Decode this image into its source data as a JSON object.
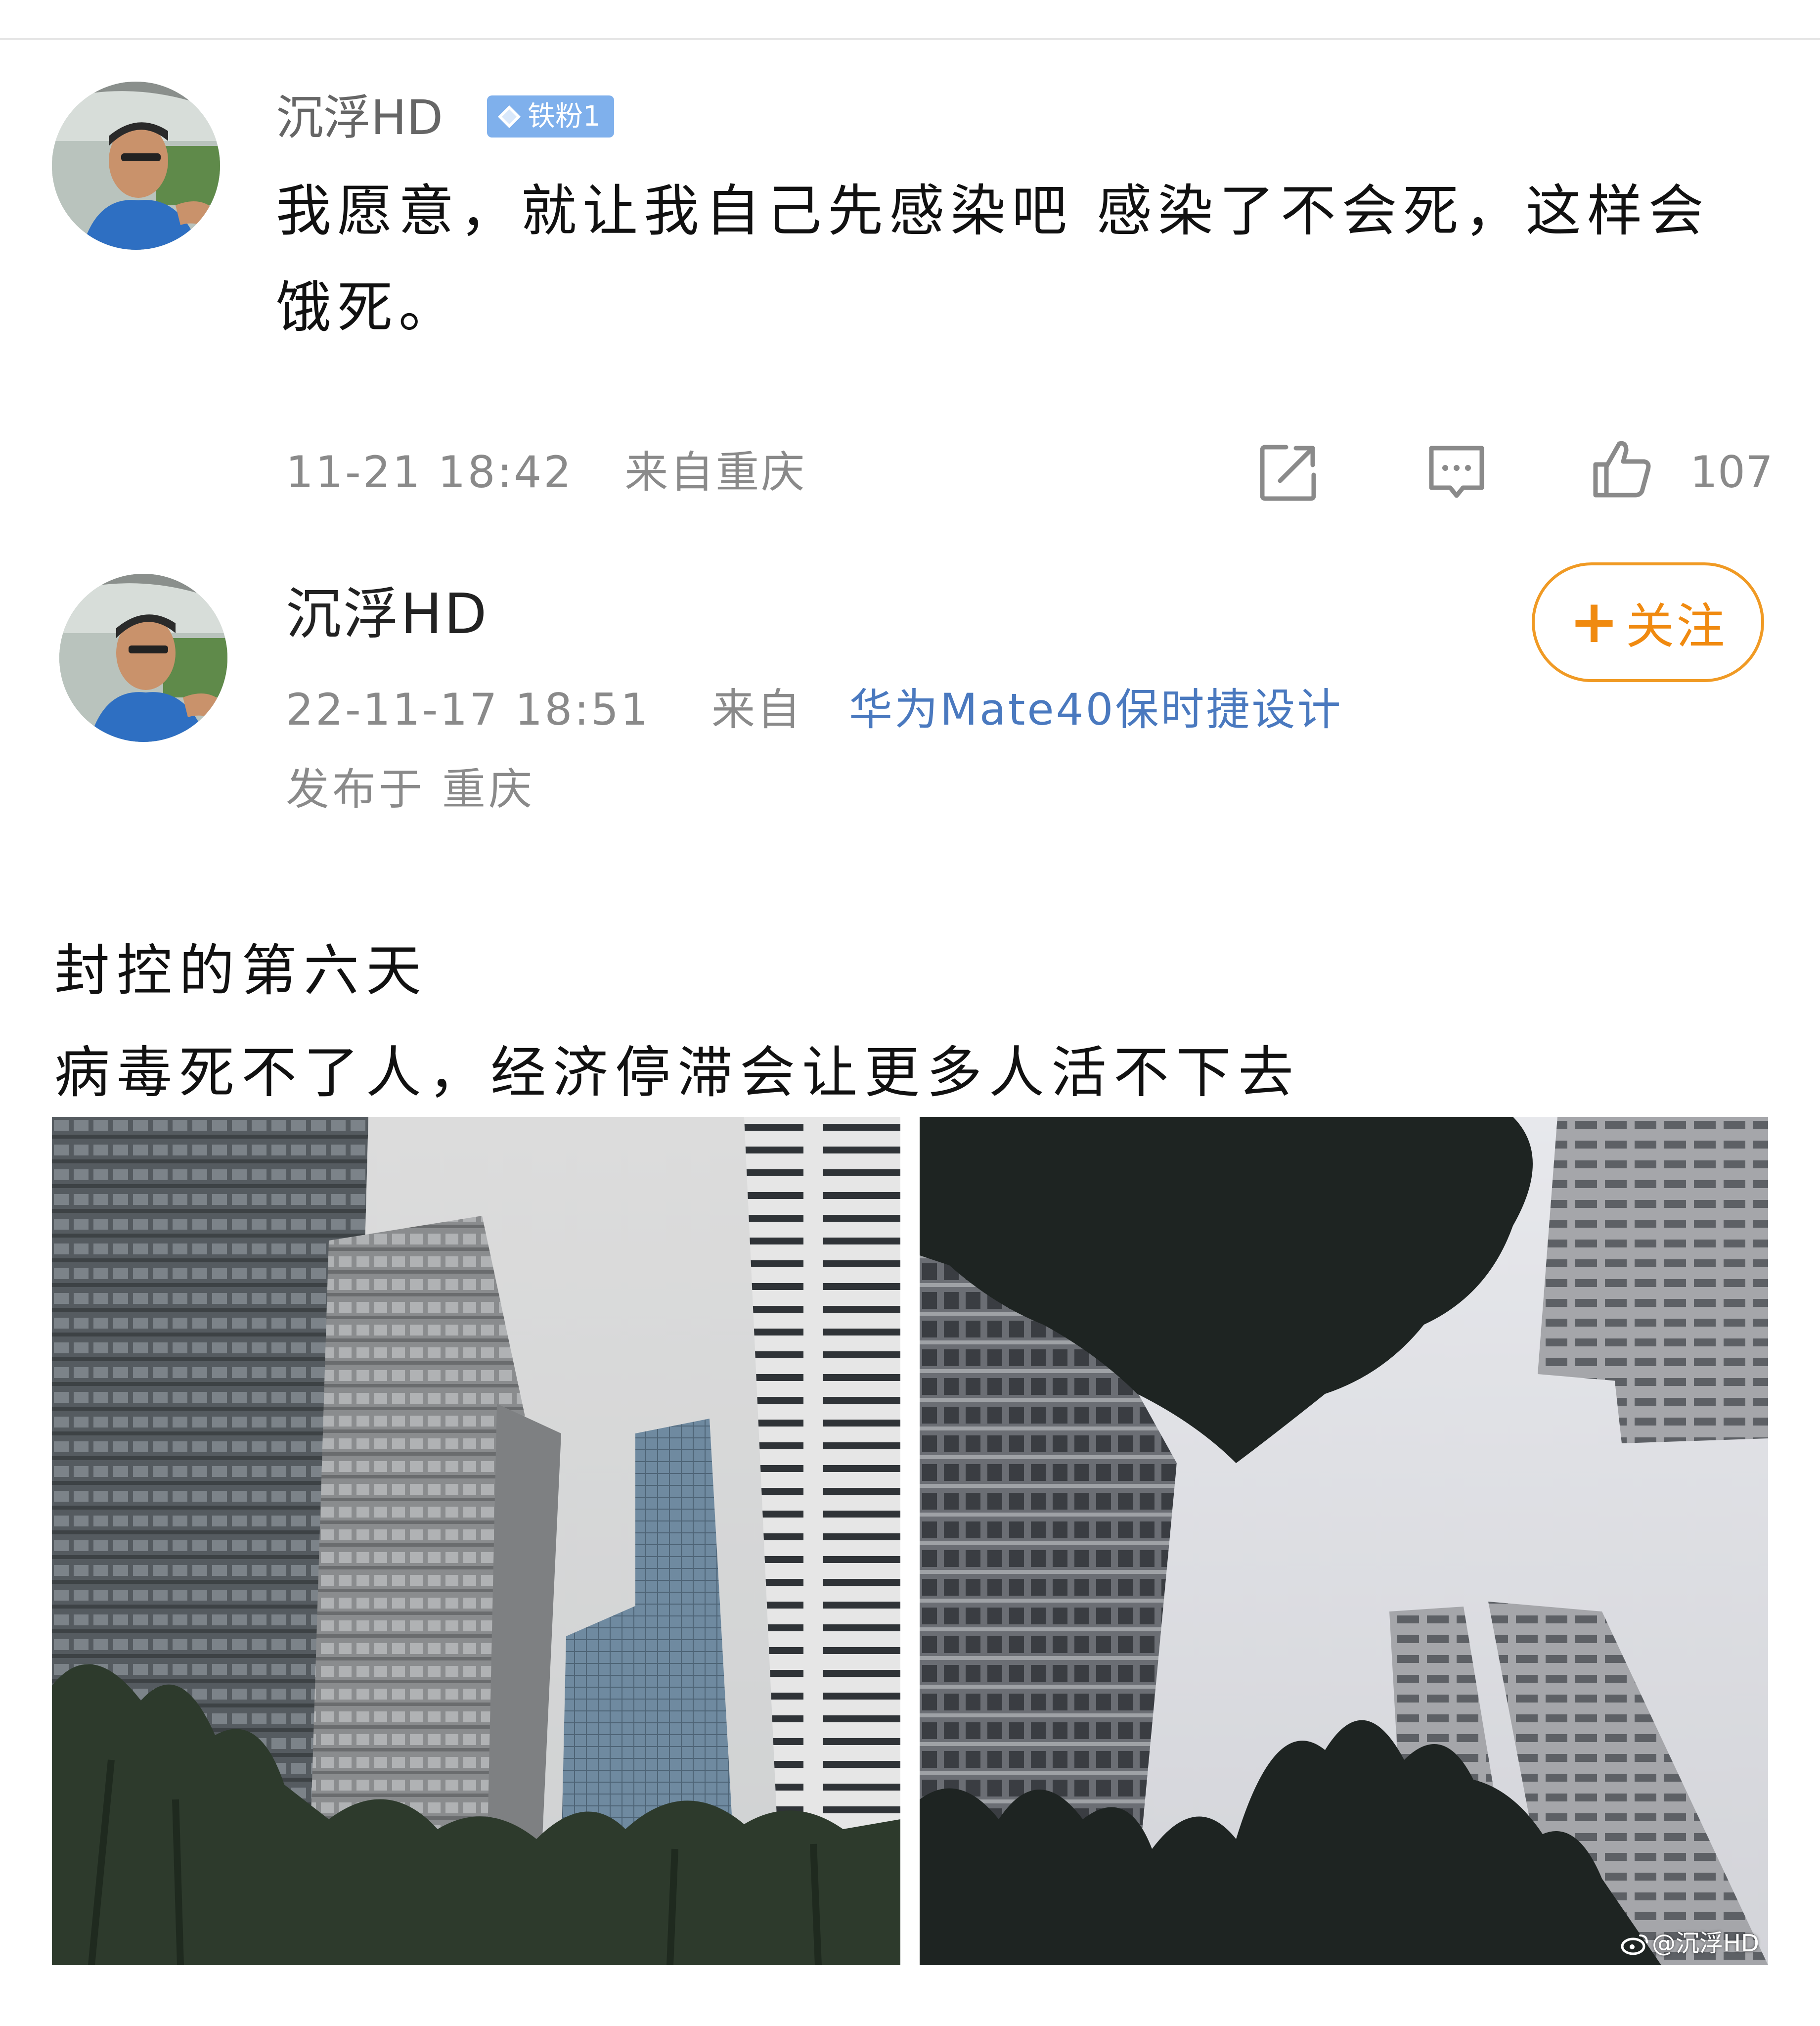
{
  "comment": {
    "username": "沉浮HD",
    "fan_badge": "铁粉1",
    "text": "我愿意，就让我自己先感染吧 感染了不会死，这样会饿死。",
    "time": "11-21 18:42",
    "location": "来自重庆",
    "like_count": "107",
    "icons": [
      "share-icon",
      "reply-icon",
      "like-icon"
    ]
  },
  "post": {
    "username": "沉浮HD",
    "follow_label": "关注",
    "date": "22-11-17 18:51",
    "from_label": "来自",
    "device": "华为Mate40保时捷设计",
    "location": "发布于 重庆",
    "text_lines": [
      "封控的第六天",
      "病毒死不了人，经济停滞会让更多人活不下去"
    ],
    "watermark": "@沉浮HD"
  },
  "colors": {
    "follow_orange": "#f08a10",
    "link_blue": "#4a79bf",
    "badge_blue": "#7fb0ec",
    "meta_gray": "#8a8a8a"
  }
}
